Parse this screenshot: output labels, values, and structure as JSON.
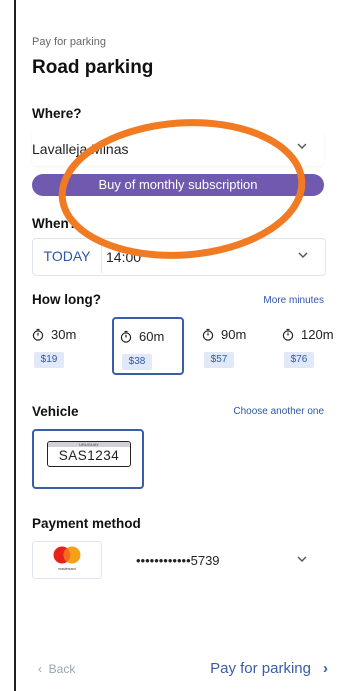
{
  "header": {
    "breadcrumb": "Pay for parking",
    "title": "Road parking"
  },
  "where": {
    "label": "Where?",
    "value": "Lavalleja Minas",
    "subscription_button": "Buy of monthly subscription"
  },
  "when": {
    "label": "When?",
    "day": "TODAY",
    "time": "14:00"
  },
  "how_long": {
    "label": "How long?",
    "more_link": "More minutes",
    "options": [
      {
        "duration": "30m",
        "price": "$19"
      },
      {
        "duration": "60m",
        "price": "$38"
      },
      {
        "duration": "90m",
        "price": "$57"
      },
      {
        "duration": "120m",
        "price": "$76"
      }
    ],
    "selected": "60m"
  },
  "vehicle": {
    "label": "Vehicle",
    "choose_link": "Choose another one",
    "plate_country": "URUGUAY",
    "plate": "SAS1234"
  },
  "payment": {
    "label": "Payment method",
    "card_brand": "mastercard",
    "card_number": "••••••••••••5739"
  },
  "footer": {
    "back": "Back",
    "pay": "Pay for parking"
  },
  "colors": {
    "accent": "#3b5ca6",
    "subscription_bg": "#6f5ab0",
    "annotation": "#f07b22"
  },
  "icons": {
    "chevron": "chevron-down-icon",
    "clock": "stopwatch-icon",
    "back_arrow": "chevron-left-icon",
    "forward_arrow": "chevron-right-icon"
  }
}
